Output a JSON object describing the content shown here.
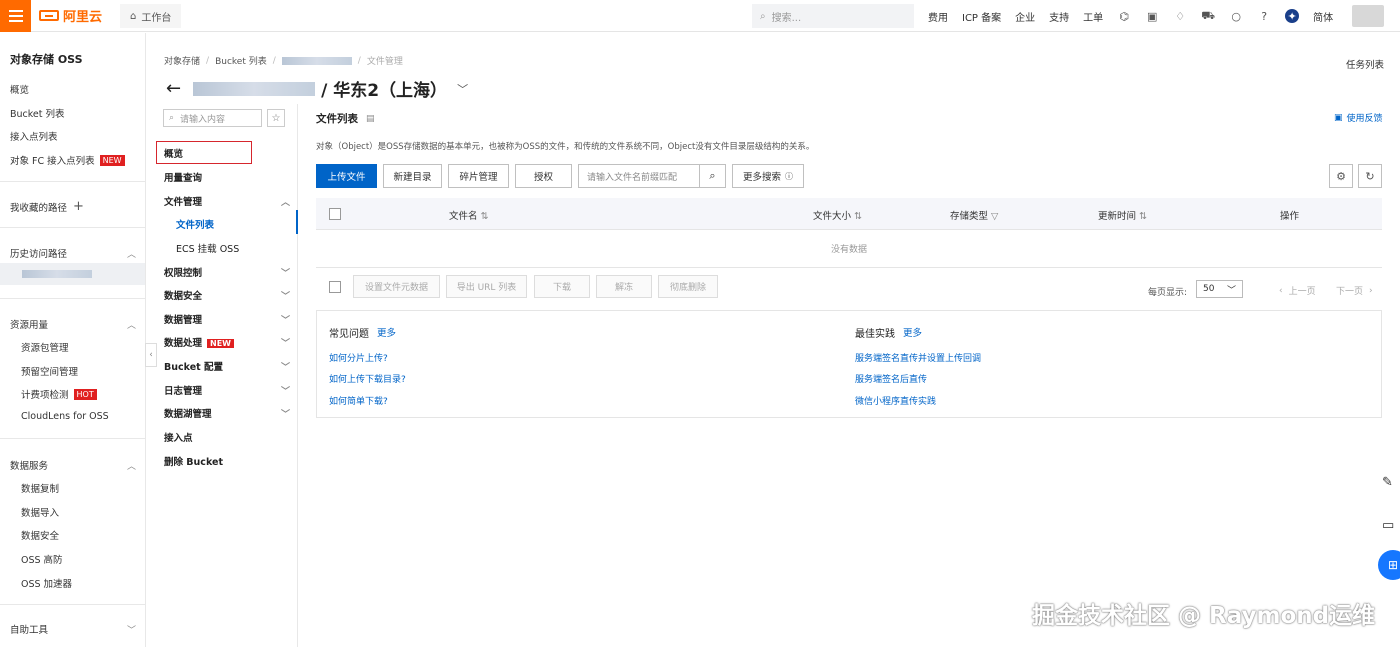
{
  "topbar": {
    "logo_text": "阿里云",
    "workbench": "工作台",
    "search_placeholder": "搜索...",
    "links": [
      "费用",
      "ICP 备案",
      "企业",
      "支持",
      "工单"
    ],
    "lang": "简体"
  },
  "sidebar": {
    "title": "对象存储 OSS",
    "items": [
      "概览",
      "Bucket 列表",
      "接入点列表",
      "对象 FC 接入点列表"
    ],
    "new_tag": "NEW",
    "favorites": "我收藏的路径",
    "history": "历史访问路径",
    "resources": "资源用量",
    "resource_items": [
      "资源包管理",
      "预留空间管理",
      "计费项检测",
      "CloudLens for OSS"
    ],
    "hot_tag": "HOT",
    "data_services": "数据服务",
    "data_items": [
      "数据复制",
      "数据导入",
      "数据安全",
      "OSS 高防",
      "OSS 加速器"
    ],
    "self_tools": "自助工具"
  },
  "breadcrumb": [
    "对象存储",
    "Bucket 列表",
    "文件管理"
  ],
  "task_list": "任务列表",
  "page_title": "/ 华东2（上海）",
  "nav2": {
    "search_placeholder": "请输入内容",
    "overview": "概览",
    "usage": "用量查询",
    "file_mgmt": "文件管理",
    "file_list": "文件列表",
    "ecs_mount": "ECS 挂载 OSS",
    "permission": "权限控制",
    "data_security": "数据安全",
    "data_mgmt": "数据管理",
    "data_process": "数据处理",
    "new_tag": "NEW",
    "bucket_config": "Bucket 配置",
    "log_mgmt": "日志管理",
    "data_lake": "数据湖管理",
    "access_point": "接入点",
    "delete_bucket": "删除 Bucket"
  },
  "main": {
    "title": "文件列表",
    "feedback": "使用反馈",
    "description": "对象（Object）是OSS存储数据的基本单元，也被称为OSS的文件，和传统的文件系统不同，Object没有文件目录层级结构的关系。",
    "buttons": {
      "upload": "上传文件",
      "new_dir": "新建目录",
      "fragments": "碎片管理",
      "authorize": "授权",
      "more_search": "更多搜索"
    },
    "file_search_placeholder": "请输入文件名前缀匹配",
    "columns": [
      "文件名",
      "文件大小",
      "存储类型",
      "更新时间",
      "操作"
    ],
    "empty": "没有数据",
    "bulk": [
      "设置文件元数据",
      "导出 URL 列表",
      "下载",
      "解冻",
      "彻底删除"
    ],
    "pager": {
      "label": "每页显示:",
      "size": "50",
      "prev": "上一页",
      "next": "下一页"
    },
    "faq": {
      "title": "常见问题",
      "more": "更多",
      "links": [
        "如何分片上传?",
        "如何上传下载目录?",
        "如何简单下载?"
      ]
    },
    "best": {
      "title": "最佳实践",
      "more": "更多",
      "links": [
        "服务端签名直传并设置上传回调",
        "服务端签名后直传",
        "微信小程序直传实践"
      ]
    }
  },
  "watermark": "掘金技术社区 @ Raymond运维",
  "colors": {
    "brand": "#ff6a00",
    "primary": "#0064c8",
    "tag": "#e02020",
    "highlight_border": "#d6262d"
  }
}
